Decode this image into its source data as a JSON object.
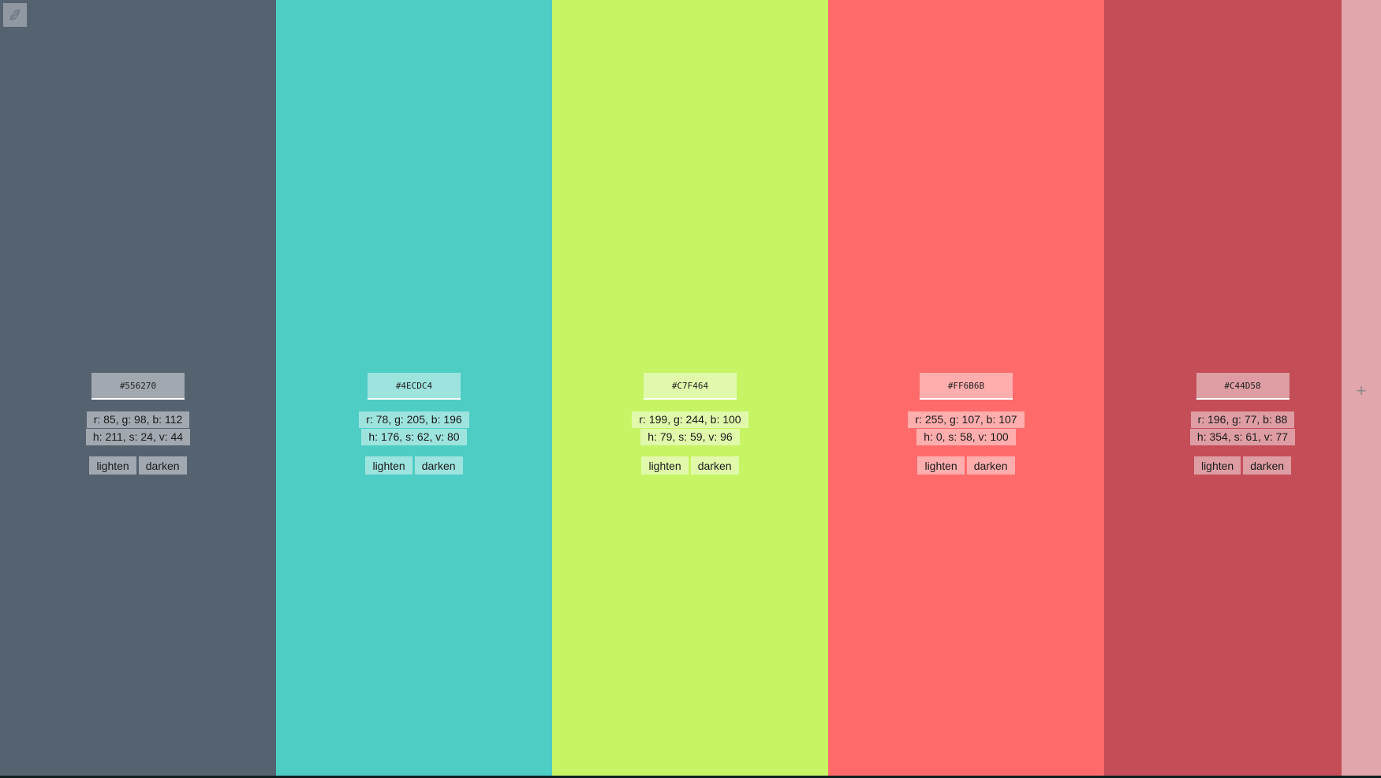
{
  "swatches": [
    {
      "hex": "#556270",
      "rgb_text": "r: 85, g: 98, b: 112",
      "hsv_text": "h: 211, s: 24, v: 44",
      "lighten_label": "lighten",
      "darken_label": "darken"
    },
    {
      "hex": "#4ECDC4",
      "rgb_text": "r: 78, g: 205, b: 196",
      "hsv_text": "h: 176, s: 62, v: 80",
      "lighten_label": "lighten",
      "darken_label": "darken"
    },
    {
      "hex": "#C7F464",
      "rgb_text": "r: 199, g: 244, b: 100",
      "hsv_text": "h: 79, s: 59, v: 96",
      "lighten_label": "lighten",
      "darken_label": "darken"
    },
    {
      "hex": "#FF6B6B",
      "rgb_text": "r: 255, g: 107, b: 107",
      "hsv_text": "h: 0, s: 58, v: 100",
      "lighten_label": "lighten",
      "darken_label": "darken"
    },
    {
      "hex": "#C44D58",
      "rgb_text": "r: 196, g: 77, b: 88",
      "hsv_text": "h: 354, s: 61, v: 77",
      "lighten_label": "lighten",
      "darken_label": "darken"
    }
  ],
  "add_strip": {
    "label": "+",
    "color": "#E0A6AB"
  },
  "link_toggle": {
    "icon": "link-broken-icon"
  }
}
